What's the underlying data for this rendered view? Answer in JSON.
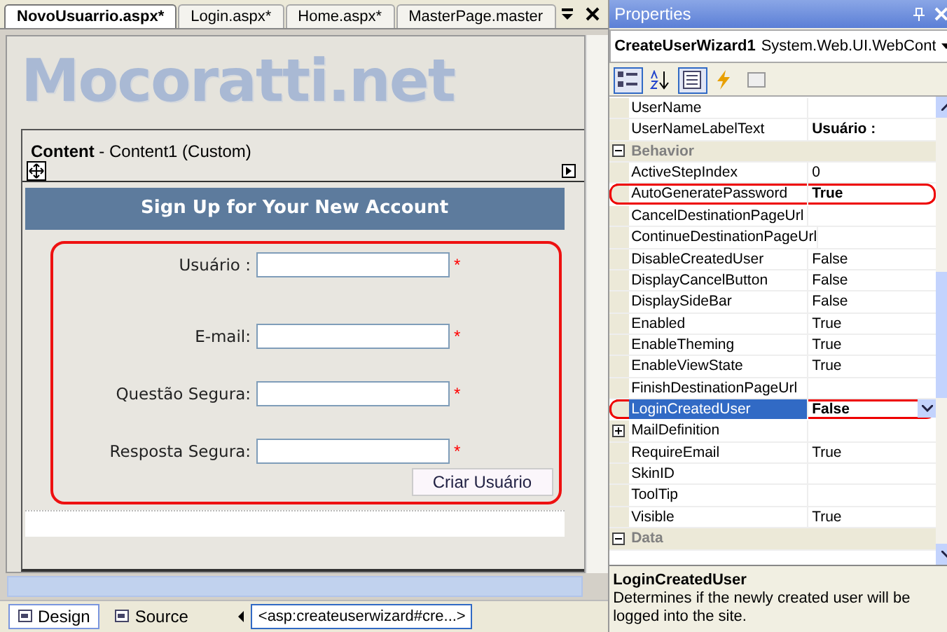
{
  "editor": {
    "tabs": [
      {
        "label": "NovoUsuarrio.aspx*",
        "selected": true
      },
      {
        "label": "Login.aspx*",
        "selected": false
      },
      {
        "label": "Home.aspx*",
        "selected": false
      },
      {
        "label": "MasterPage.master",
        "selected": false
      }
    ],
    "logo": "Mocoratti.net",
    "content_region": {
      "title": "Content",
      "subtitle": "- Content1 (Custom)"
    },
    "wizard": {
      "title": "Sign Up for Your New Account",
      "highlighted": true,
      "fields": [
        {
          "label": "Usuário :",
          "required_mark": "*"
        },
        {
          "label": "E-mail:",
          "required_mark": "*"
        },
        {
          "label": "Questão Segura:",
          "required_mark": "*"
        },
        {
          "label": "Resposta Segura:",
          "required_mark": "*"
        }
      ],
      "submit_button": "Criar Usuário"
    },
    "view_tabs": [
      {
        "label": "Design",
        "selected": true
      },
      {
        "label": "Source",
        "selected": false
      }
    ],
    "tag_path": "<asp:createuserwizard#cre...>"
  },
  "properties": {
    "title": "Properties",
    "object_name": "CreateUserWizard1",
    "object_type": "System.Web.UI.WebCont",
    "toolbar": [
      {
        "kind": "categorized",
        "selected": true
      },
      {
        "kind": "alphabetical",
        "selected": false
      },
      {
        "kind": "properties",
        "selected": true
      },
      {
        "kind": "events",
        "selected": false
      },
      {
        "kind": "pages",
        "selected": false
      }
    ],
    "rows": [
      {
        "kind": "property",
        "name": "UserName",
        "selected": false,
        "highlighted": false
      },
      {
        "kind": "property",
        "name": "UserNameLabelText",
        "value": "Usuário :",
        "bold": true,
        "selected": false,
        "highlighted": false
      },
      {
        "kind": "category",
        "name": "Behavior",
        "expanded": true
      },
      {
        "kind": "property",
        "name": "ActiveStepIndex",
        "value": "0",
        "bold": false,
        "selected": false,
        "highlighted": false
      },
      {
        "kind": "property",
        "name": "AutoGeneratePassword",
        "value": "True",
        "bold": true,
        "selected": false,
        "highlighted": true
      },
      {
        "kind": "property",
        "name": "CancelDestinationPageUrl",
        "selected": false,
        "highlighted": false
      },
      {
        "kind": "property",
        "name": "ContinueDestinationPageUrl",
        "selected": false,
        "highlighted": false
      },
      {
        "kind": "property",
        "name": "DisableCreatedUser",
        "value": "False",
        "bold": false,
        "selected": false,
        "highlighted": false
      },
      {
        "kind": "property",
        "name": "DisplayCancelButton",
        "value": "False",
        "bold": false,
        "selected": false,
        "highlighted": false
      },
      {
        "kind": "property",
        "name": "DisplaySideBar",
        "value": "False",
        "bold": false,
        "selected": false,
        "highlighted": false
      },
      {
        "kind": "property",
        "name": "Enabled",
        "value": "True",
        "bold": false,
        "selected": false,
        "highlighted": false
      },
      {
        "kind": "property",
        "name": "EnableTheming",
        "value": "True",
        "bold": false,
        "selected": false,
        "highlighted": false
      },
      {
        "kind": "property",
        "name": "EnableViewState",
        "value": "True",
        "bold": false,
        "selected": false,
        "highlighted": false
      },
      {
        "kind": "property",
        "name": "FinishDestinationPageUrl",
        "selected": false,
        "highlighted": false
      },
      {
        "kind": "property",
        "name": "LoginCreatedUser",
        "value": "False",
        "bold": true,
        "selected": true,
        "highlighted": true
      },
      {
        "kind": "group",
        "name": "MailDefinition",
        "expanded": false
      },
      {
        "kind": "property",
        "name": "RequireEmail",
        "value": "True",
        "bold": false,
        "selected": false,
        "highlighted": false
      },
      {
        "kind": "property",
        "name": "SkinID",
        "selected": false,
        "highlighted": false
      },
      {
        "kind": "property",
        "name": "ToolTip",
        "selected": false,
        "highlighted": false
      },
      {
        "kind": "property",
        "name": "Visible",
        "value": "True",
        "bold": false,
        "selected": false,
        "highlighted": false
      },
      {
        "kind": "category",
        "name": "Data",
        "expanded": true
      }
    ],
    "description": {
      "title": "LoginCreatedUser",
      "text": "Determines if the newly created user will be logged into the site."
    }
  }
}
